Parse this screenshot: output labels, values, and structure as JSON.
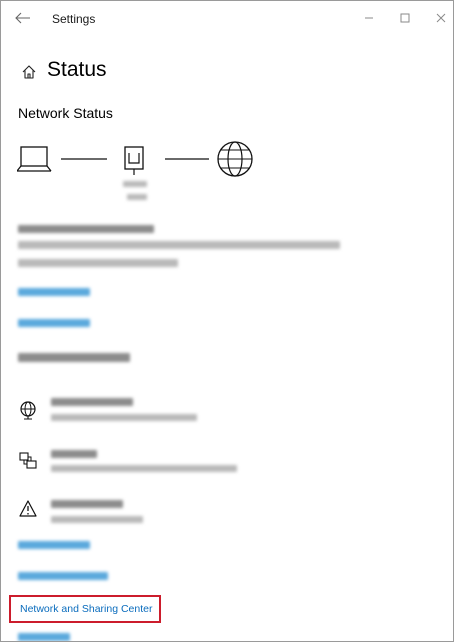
{
  "window": {
    "title": "Settings"
  },
  "header": {
    "title": "Status"
  },
  "section": {
    "title": "Network Status"
  },
  "links": {
    "network_sharing_center": "Network and Sharing Center"
  },
  "icons": {
    "back": "back-arrow-icon",
    "home": "home-icon",
    "computer": "laptop-icon",
    "router": "router-icon",
    "internet": "globe-icon",
    "ethernet_item": "globe-network-icon",
    "sharing_item": "network-sharing-icon",
    "warning_item": "warning-icon"
  },
  "colors": {
    "link": "#0a6cbd",
    "highlight_box": "#cc1c2c"
  }
}
